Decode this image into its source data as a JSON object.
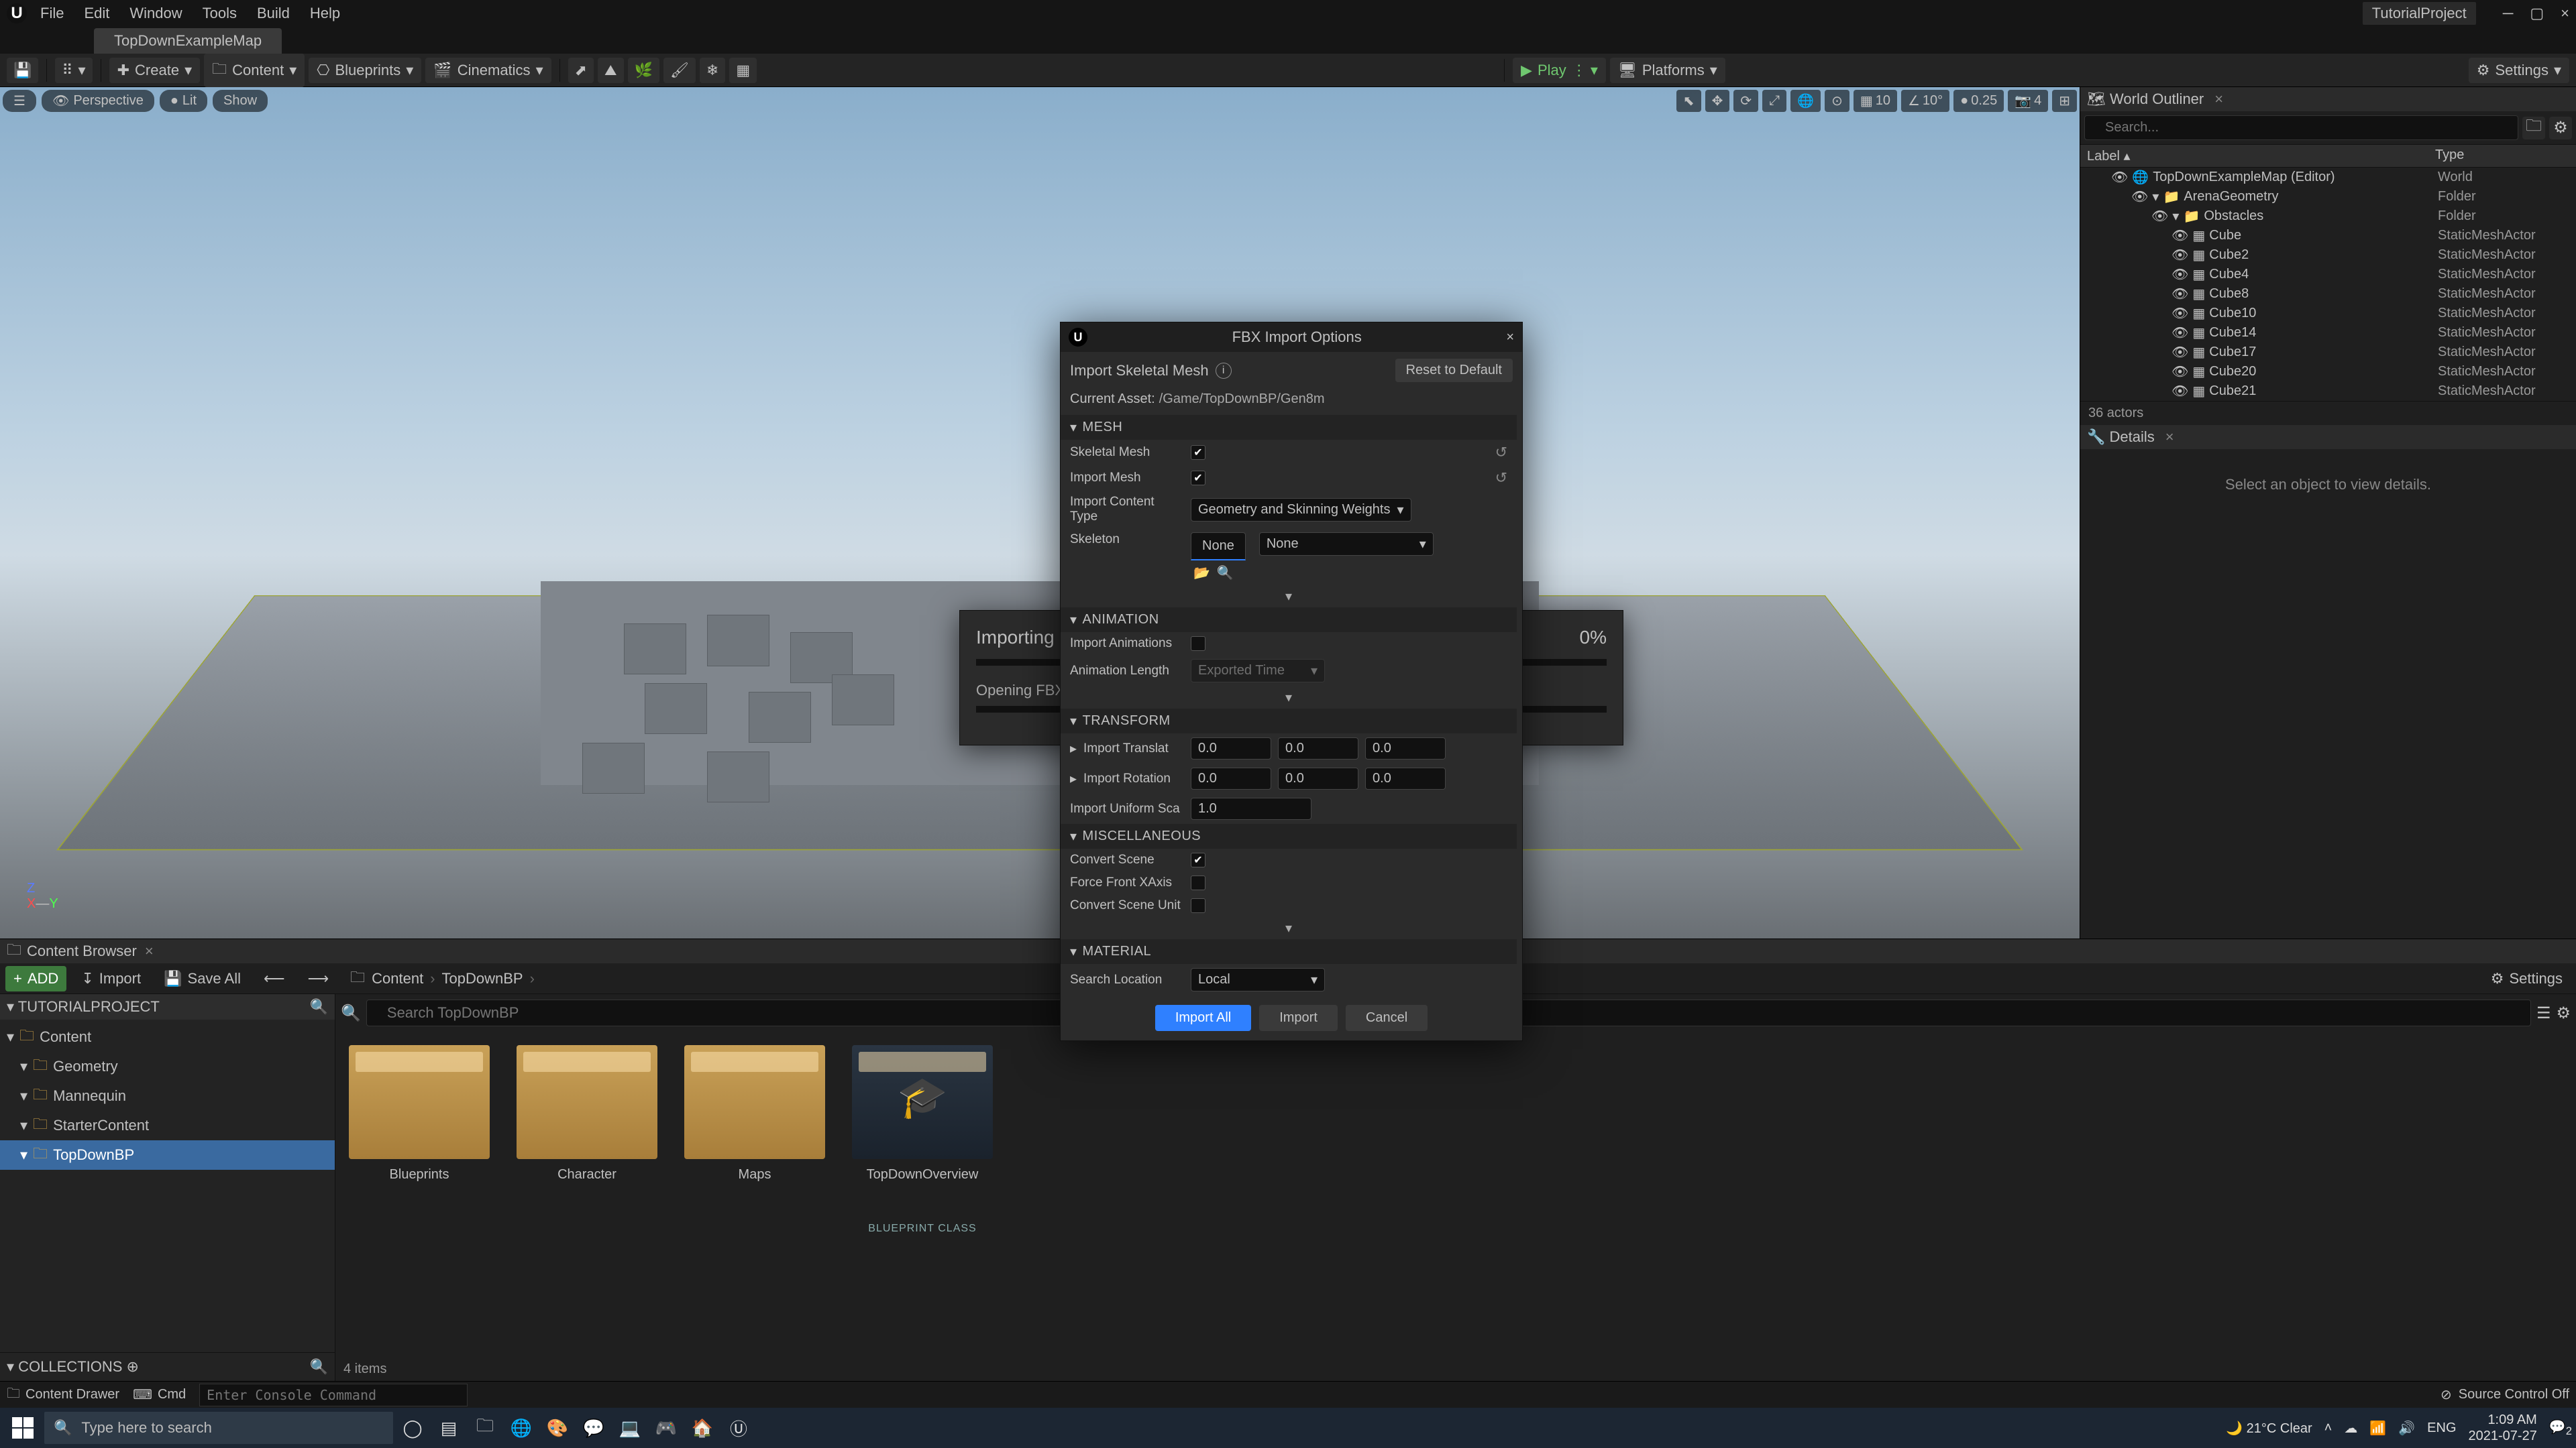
{
  "app": {
    "project": "TutorialProject",
    "genericIcon": "⚙",
    "closeX": "×"
  },
  "menu": {
    "file": "File",
    "edit": "Edit",
    "window": "Window",
    "tools": "Tools",
    "build": "Build",
    "help": "Help"
  },
  "mainTab": "TopDownExampleMap",
  "toolbar": {
    "save": "💾",
    "modes": "⠿",
    "create": "Create",
    "content": "Content",
    "blueprints": "Blueprints",
    "cinematics": "Cinematics",
    "play": "Play",
    "platforms": "Platforms",
    "settings": "Settings"
  },
  "viewport": {
    "menu": "☰",
    "perspective": "Perspective",
    "lit": "Lit",
    "show": "Show",
    "grid": "10",
    "angle": "10°",
    "scale": "0.25",
    "cam": "4"
  },
  "importing": {
    "title": "Importing",
    "pct": "0%",
    "sub": "Opening FBX"
  },
  "fbx": {
    "title": "FBX Import Options",
    "subtitle": "Import Skeletal Mesh",
    "reset": "Reset to Default",
    "currentLabel": "Current Asset:",
    "currentPath": "/Game/TopDownBP/Gen8m",
    "sect_mesh": "Mesh",
    "skeletalMesh": "Skeletal Mesh",
    "importMesh": "Import Mesh",
    "importContentType": "Import Content Type",
    "importContentTypeVal": "Geometry and Skinning Weights",
    "skeleton": "Skeleton",
    "skeletonBtn": "None",
    "skeletonCombo": "None",
    "sect_anim": "Animation",
    "importAnimations": "Import Animations",
    "animLength": "Animation Length",
    "animLengthVal": "Exported Time",
    "sect_trans": "Transform",
    "importTrans": "Import Translat",
    "importRot": "Import Rotation",
    "importScale": "Import Uniform Sca",
    "zero": "0.0",
    "one": "1.0",
    "sect_misc": "Miscellaneous",
    "convertScene": "Convert Scene",
    "forceFront": "Force Front XAxis",
    "convertSceneUnit": "Convert Scene Unit",
    "sect_mat": "Material",
    "searchLocation": "Search Location",
    "searchLocationVal": "Local",
    "chev": "▾",
    "arrowRight": "▸",
    "resetIcon": "↺",
    "searchIcon": "🔍",
    "folderOpen": "📂",
    "importAll": "Import All",
    "import": "Import",
    "cancel": "Cancel"
  },
  "outliner": {
    "tab": "World Outliner",
    "searchPh": "Search...",
    "labelHdr": "Label",
    "typeHdr": "Type",
    "footer": "36 actors",
    "rows": [
      {
        "indent": 1,
        "icon": "🌐",
        "label": "TopDownExampleMap (Editor)",
        "type": "World"
      },
      {
        "indent": 2,
        "icon": "📁",
        "label": "ArenaGeometry",
        "type": "Folder",
        "fold": true
      },
      {
        "indent": 3,
        "icon": "📁",
        "label": "Obstacles",
        "type": "Folder",
        "fold": true
      },
      {
        "indent": 4,
        "icon": "▦",
        "label": "Cube",
        "type": "StaticMeshActor"
      },
      {
        "indent": 4,
        "icon": "▦",
        "label": "Cube2",
        "type": "StaticMeshActor"
      },
      {
        "indent": 4,
        "icon": "▦",
        "label": "Cube4",
        "type": "StaticMeshActor"
      },
      {
        "indent": 4,
        "icon": "▦",
        "label": "Cube8",
        "type": "StaticMeshActor"
      },
      {
        "indent": 4,
        "icon": "▦",
        "label": "Cube10",
        "type": "StaticMeshActor"
      },
      {
        "indent": 4,
        "icon": "▦",
        "label": "Cube14",
        "type": "StaticMeshActor"
      },
      {
        "indent": 4,
        "icon": "▦",
        "label": "Cube17",
        "type": "StaticMeshActor"
      },
      {
        "indent": 4,
        "icon": "▦",
        "label": "Cube20",
        "type": "StaticMeshActor"
      },
      {
        "indent": 4,
        "icon": "▦",
        "label": "Cube21",
        "type": "StaticMeshActor"
      }
    ]
  },
  "details": {
    "tab": "Details",
    "placeholder": "Select an object to view details."
  },
  "contentBrowser": {
    "tab": "Content Browser",
    "add": "ADD",
    "import": "Import",
    "saveAll": "Save All",
    "crumbContent": "Content",
    "crumbFolder": "TopDownBP",
    "settings": "Settings",
    "treeHdr": "TUTORIALPROJECT",
    "tree": [
      {
        "indent": 0,
        "label": "Content",
        "fold": true
      },
      {
        "indent": 1,
        "label": "Geometry",
        "fold": true
      },
      {
        "indent": 1,
        "label": "Mannequin",
        "fold": true
      },
      {
        "indent": 1,
        "label": "StarterContent",
        "fold": true
      },
      {
        "indent": 1,
        "label": "TopDownBP",
        "fold": true,
        "sel": true
      }
    ],
    "collections": "COLLECTIONS",
    "searchPh": "Search TopDownBP",
    "assets": {
      "0": {
        "name": "Blueprints"
      },
      "1": {
        "name": "Character"
      },
      "2": {
        "name": "Maps"
      },
      "3": {
        "name": "TopDownOverview",
        "meta": "BLUEPRINT CLASS"
      }
    },
    "footer": "4 items"
  },
  "drawer": {
    "contentDrawer": "Content Drawer",
    "cmd": "Cmd",
    "consolePh": "Enter Console Command",
    "sourceControl": "Source Control Off",
    "blockIcon": "⊘"
  },
  "taskbar": {
    "searchPh": "Type here to search",
    "weather": "21°C  Clear",
    "moon": "🌙",
    "up": "˄",
    "wifi": "📶",
    "vol": "🔊",
    "lang": "ENG",
    "time": "1:09 AM",
    "date": "2021-07-27",
    "notif": "💬",
    "notifCount": "2"
  }
}
